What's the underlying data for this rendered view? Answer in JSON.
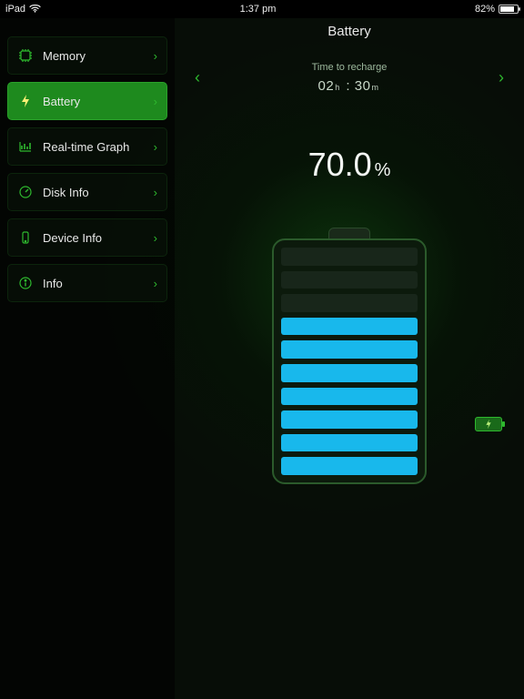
{
  "status_bar": {
    "device": "iPad",
    "time": "1:37 pm",
    "battery_pct": "82%",
    "battery_fill_pct": 82
  },
  "header": {
    "title": "Battery"
  },
  "sidebar": {
    "items": [
      {
        "label": "Memory",
        "icon": "chip-icon"
      },
      {
        "label": "Battery",
        "icon": "bolt-icon"
      },
      {
        "label": "Real-time Graph",
        "icon": "graph-icon"
      },
      {
        "label": "Disk Info",
        "icon": "gauge-icon"
      },
      {
        "label": "Device Info",
        "icon": "device-icon"
      },
      {
        "label": "Info",
        "icon": "info-icon"
      }
    ],
    "active_index": 1
  },
  "carousel": {
    "caption": "Time to recharge",
    "hours": "02",
    "hours_unit": "h",
    "separator": ":",
    "minutes": "30",
    "minutes_unit": "m"
  },
  "battery": {
    "percent_value": "70.0",
    "percent_sign": "%",
    "total_bars": 10,
    "filled_bars": 7,
    "fill_color": "#18b8ec",
    "charging": true
  },
  "colors": {
    "accent": "#2eb82e"
  }
}
